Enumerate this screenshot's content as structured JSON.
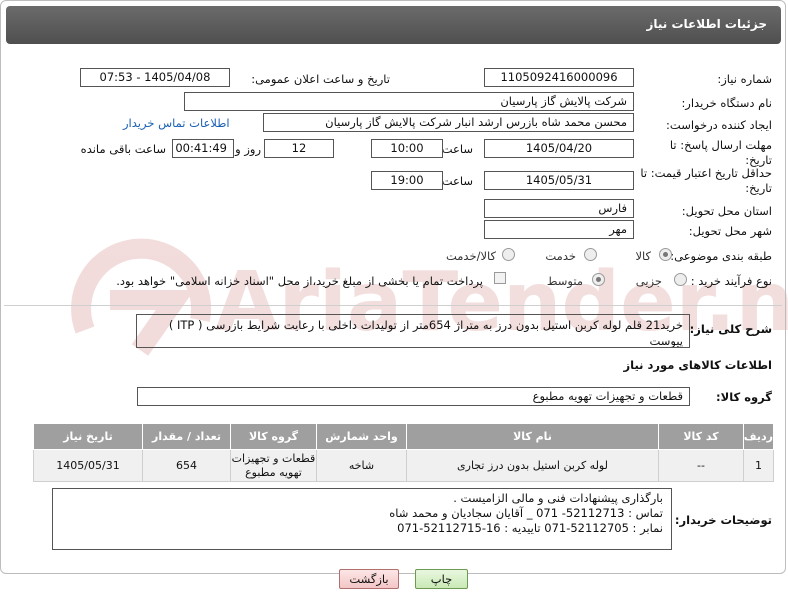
{
  "header": {
    "title": "جزئیات اطلاعات نیاز"
  },
  "fields": {
    "need_number_label": "شماره نیاز:",
    "need_number": "1105092416000096",
    "announce_label": "تاریخ و ساعت اعلان عمومی:",
    "announce_value": "1405/04/08 - 07:53",
    "buyer_org_label": "نام دستگاه خریدار:",
    "buyer_org": "شرکت پالایش گاز پارسیان",
    "creator_label": "ایجاد کننده درخواست:",
    "creator": "محسن محمد شاه بازرس ارشد انبار شرکت پالایش گاز پارسیان",
    "buyer_contact_link": "اطلاعات تماس خریدار",
    "deadline_label": "مهلت ارسال پاسخ: تا تاریخ:",
    "deadline_date": "1405/04/20",
    "time_label": "ساعت",
    "deadline_time": "10:00",
    "days_count": "12",
    "days_label": "روز و",
    "remaining_time": "00:41:49",
    "remaining_label": "ساعت باقی مانده",
    "validity_label": "حداقل تاریخ اعتبار قیمت: تا تاریخ:",
    "validity_date": "1405/05/31",
    "validity_time_label": "ساعت",
    "validity_time": "19:00",
    "province_label": "استان محل تحویل:",
    "province": "فارس",
    "city_label": "شهر محل تحویل:",
    "city": "مهر",
    "category_label": "طبقه بندی موضوعی:",
    "category_options": [
      "کالا",
      "خدمت",
      "کالا/خدمت"
    ],
    "process_label": "نوع فرآیند خرید :",
    "process_options": [
      "جزیی",
      "متوسط"
    ],
    "payment_note": "پرداخت تمام یا بخشی از مبلغ خرید،از محل \"اسناد خزانه اسلامی\" خواهد بود."
  },
  "description": {
    "label": "شرح کلی نیاز:",
    "text": "خرید21 قلم  لوله کربن استیل بدون درز به متراژ 654متر از تولیدات داخلی با رعایت شرایط بازرسی ( ITP ) پیوست"
  },
  "goods": {
    "section_title": "اطلاعات کالاهای مورد نیاز",
    "group_label": "گروه کالا:",
    "group_value": "قطعات و تجهیزات تهویه مطبوع",
    "columns": [
      "ردیف",
      "کد کالا",
      "نام کالا",
      "واحد شمارش",
      "گروه کالا",
      "تعداد / مقدار",
      "تاریخ نیاز"
    ],
    "rows": [
      {
        "row": "1",
        "code": "--",
        "name": "لوله کربن استیل بدون درز تجاری",
        "unit": "شاخه",
        "group": "قطعات و تجهیزات تهویه مطبوع",
        "qty": "654",
        "date": "1405/05/31"
      }
    ]
  },
  "buyer_notes": {
    "label": "توضیحات خریدار:",
    "lines": [
      "بارگذاری پیشنهادات فنی و مالی الزامیست .",
      "تماس : 52112713- 071 _ آقایان سجادیان و محمد شاه",
      "نمابر : 52112705-071 تاییدیه : 16-52112715-071"
    ]
  },
  "buttons": {
    "print": "چاپ",
    "back": "بازگشت"
  },
  "watermark": {
    "text": "AriaTender.net"
  },
  "colors": {
    "header_bg": "#5a5a5a",
    "table_header_bg": "#9f9f9f",
    "link": "#1a5fb4",
    "watermark": "#e8c9c9"
  }
}
